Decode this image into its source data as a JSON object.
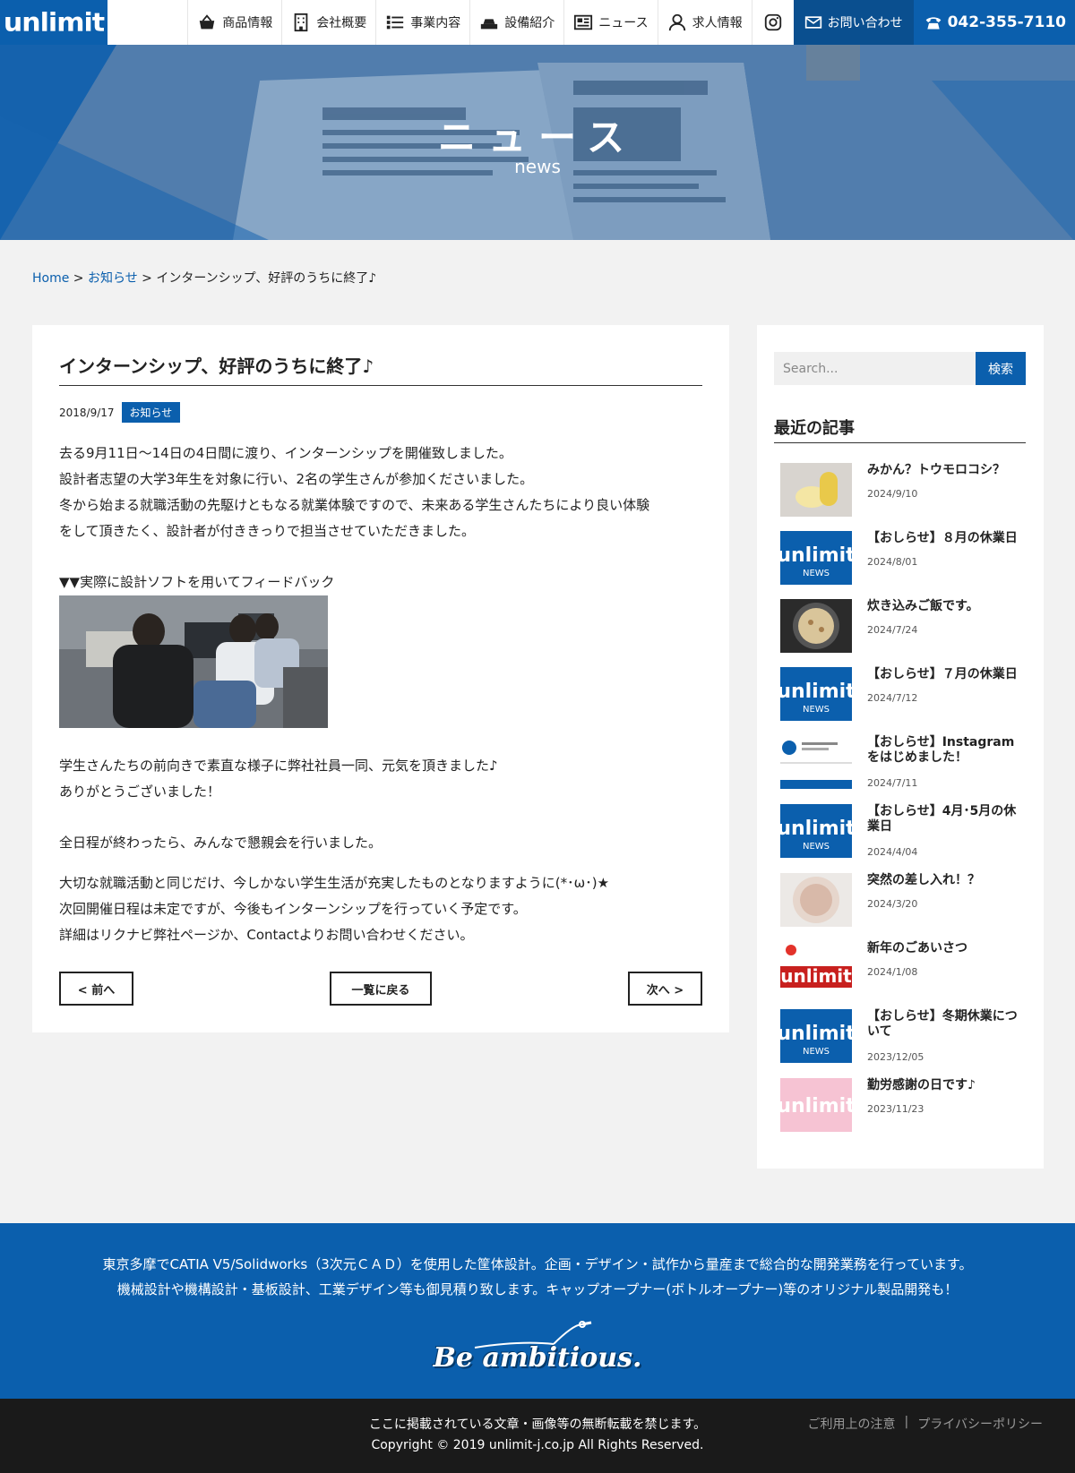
{
  "header": {
    "logo": "unlimit",
    "nav": [
      {
        "label": "商品情報",
        "icon": "basket-icon"
      },
      {
        "label": "会社概要",
        "icon": "building-icon"
      },
      {
        "label": "事業内容",
        "icon": "list-icon"
      },
      {
        "label": "設備紹介",
        "icon": "machine-icon"
      },
      {
        "label": "ニュース",
        "icon": "newspaper-icon"
      },
      {
        "label": "求人情報",
        "icon": "person-icon"
      }
    ],
    "contact": "お問い合わせ",
    "tel": "042-355-7110"
  },
  "hero": {
    "title": "ニュース",
    "subtitle": "news"
  },
  "breadcrumb": {
    "home": "Home",
    "sep": ">",
    "cat": "お知らせ",
    "current": "インターンシップ、好評のうちに終了♪"
  },
  "article": {
    "title": "インターンシップ、好評のうちに終了♪",
    "date": "2018/9/17",
    "category": "お知らせ",
    "p1": "去る9月11日～14日の4日間に渡り、インターンシップを開催致しました。",
    "p2": "設計者志望の大学3年生を対象に行い、2名の学生さんが参加くださいました。",
    "p3": "冬から始まる就職活動の先駆けともなる就業体験ですので、未来ある学生さんたちにより良い体験",
    "p4": "をして頂きたく、設計者が付ききっりで担当させていただきました。",
    "p5": "▼▼実際に設計ソフトを用いてフィードバック",
    "p6": "学生さんたちの前向きで素直な様子に弊社社員一同、元気を頂きました♪",
    "p7": "ありがとうございました！",
    "p8": "全日程が終わったら、みんなで懇親会を行いました。",
    "p9": "大切な就職活動と同じだけ、今しかない学生生活が充実したものとなりますように(*･ω･)★",
    "p10": "次回開催日程は未定ですが、今後もインターンシップを行っていく予定です。",
    "p11": "詳細はリクナビ弊社ページか、Contactよりお問い合わせください。",
    "prev": "< 前へ",
    "list": "一覧に戻る",
    "next": "次へ >"
  },
  "sidebar": {
    "search_placeholder": "Search...",
    "search_button": "検索",
    "recent_title": "最近の記事",
    "posts": [
      {
        "title": "みかん？トウモロコシ？",
        "date": "2024/9/10",
        "thumb": "corn"
      },
      {
        "title": "【おしらせ】８月の休業日",
        "date": "2024/8/01",
        "thumb": "news"
      },
      {
        "title": "炊き込みご飯です。",
        "date": "2024/7/24",
        "thumb": "rice"
      },
      {
        "title": "【おしらせ】７月の休業日",
        "date": "2024/7/12",
        "thumb": "news"
      },
      {
        "title": "【おしらせ】Instagramをはじめました！",
        "date": "2024/7/11",
        "thumb": "insta"
      },
      {
        "title": "【おしらせ】4月･5月の休業日",
        "date": "2024/4/04",
        "thumb": "news"
      },
      {
        "title": "突然の差し入れ！？",
        "date": "2024/3/20",
        "thumb": "rice2"
      },
      {
        "title": "新年のごあいさつ",
        "date": "2024/1/08",
        "thumb": "newyear"
      },
      {
        "title": "【おしらせ】冬期休業について",
        "date": "2023/12/05",
        "thumb": "news"
      },
      {
        "title": "勤労感謝の日です♪",
        "date": "2023/11/23",
        "thumb": "pink"
      }
    ]
  },
  "footer": {
    "line1": "東京多摩でCATIA V5/Solidworks（3次元ＣＡＤ）を使用した筐体設計。企画・デザイン・試作から量産まで総合的な開発業務を行っています。",
    "line2": "機械設計や機構設計・基板設計、工業デザイン等も御見積り致します。キャップオープナー(ボトルオープナー)等のオリジナル製品開発も！",
    "slogan": "Be ambitious.",
    "notice": "ここに掲載されている文章・画像等の無断転載を禁じます。",
    "copyright": "Copyright © 2019 unlimit-j.co.jp All Rights Reserved.",
    "link1": "ご利用上の注意",
    "link2": "プライバシーポリシー"
  },
  "colors": {
    "brand": "#0b5fad",
    "dark": "#0a4f8f",
    "footer_bottom": "#1a1a1a"
  }
}
